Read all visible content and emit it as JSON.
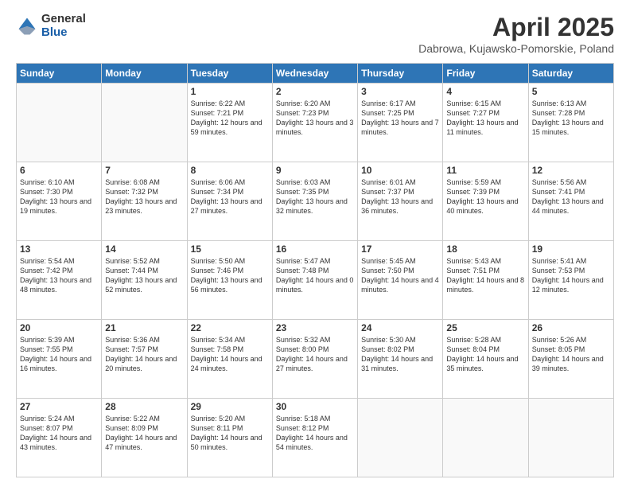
{
  "logo": {
    "general": "General",
    "blue": "Blue"
  },
  "title": {
    "main": "April 2025",
    "sub": "Dabrowa, Kujawsko-Pomorskie, Poland"
  },
  "weekdays": [
    "Sunday",
    "Monday",
    "Tuesday",
    "Wednesday",
    "Thursday",
    "Friday",
    "Saturday"
  ],
  "weeks": [
    [
      {
        "day": "",
        "info": ""
      },
      {
        "day": "",
        "info": ""
      },
      {
        "day": "1",
        "info": "Sunrise: 6:22 AM\nSunset: 7:21 PM\nDaylight: 12 hours and 59 minutes."
      },
      {
        "day": "2",
        "info": "Sunrise: 6:20 AM\nSunset: 7:23 PM\nDaylight: 13 hours and 3 minutes."
      },
      {
        "day": "3",
        "info": "Sunrise: 6:17 AM\nSunset: 7:25 PM\nDaylight: 13 hours and 7 minutes."
      },
      {
        "day": "4",
        "info": "Sunrise: 6:15 AM\nSunset: 7:27 PM\nDaylight: 13 hours and 11 minutes."
      },
      {
        "day": "5",
        "info": "Sunrise: 6:13 AM\nSunset: 7:28 PM\nDaylight: 13 hours and 15 minutes."
      }
    ],
    [
      {
        "day": "6",
        "info": "Sunrise: 6:10 AM\nSunset: 7:30 PM\nDaylight: 13 hours and 19 minutes."
      },
      {
        "day": "7",
        "info": "Sunrise: 6:08 AM\nSunset: 7:32 PM\nDaylight: 13 hours and 23 minutes."
      },
      {
        "day": "8",
        "info": "Sunrise: 6:06 AM\nSunset: 7:34 PM\nDaylight: 13 hours and 27 minutes."
      },
      {
        "day": "9",
        "info": "Sunrise: 6:03 AM\nSunset: 7:35 PM\nDaylight: 13 hours and 32 minutes."
      },
      {
        "day": "10",
        "info": "Sunrise: 6:01 AM\nSunset: 7:37 PM\nDaylight: 13 hours and 36 minutes."
      },
      {
        "day": "11",
        "info": "Sunrise: 5:59 AM\nSunset: 7:39 PM\nDaylight: 13 hours and 40 minutes."
      },
      {
        "day": "12",
        "info": "Sunrise: 5:56 AM\nSunset: 7:41 PM\nDaylight: 13 hours and 44 minutes."
      }
    ],
    [
      {
        "day": "13",
        "info": "Sunrise: 5:54 AM\nSunset: 7:42 PM\nDaylight: 13 hours and 48 minutes."
      },
      {
        "day": "14",
        "info": "Sunrise: 5:52 AM\nSunset: 7:44 PM\nDaylight: 13 hours and 52 minutes."
      },
      {
        "day": "15",
        "info": "Sunrise: 5:50 AM\nSunset: 7:46 PM\nDaylight: 13 hours and 56 minutes."
      },
      {
        "day": "16",
        "info": "Sunrise: 5:47 AM\nSunset: 7:48 PM\nDaylight: 14 hours and 0 minutes."
      },
      {
        "day": "17",
        "info": "Sunrise: 5:45 AM\nSunset: 7:50 PM\nDaylight: 14 hours and 4 minutes."
      },
      {
        "day": "18",
        "info": "Sunrise: 5:43 AM\nSunset: 7:51 PM\nDaylight: 14 hours and 8 minutes."
      },
      {
        "day": "19",
        "info": "Sunrise: 5:41 AM\nSunset: 7:53 PM\nDaylight: 14 hours and 12 minutes."
      }
    ],
    [
      {
        "day": "20",
        "info": "Sunrise: 5:39 AM\nSunset: 7:55 PM\nDaylight: 14 hours and 16 minutes."
      },
      {
        "day": "21",
        "info": "Sunrise: 5:36 AM\nSunset: 7:57 PM\nDaylight: 14 hours and 20 minutes."
      },
      {
        "day": "22",
        "info": "Sunrise: 5:34 AM\nSunset: 7:58 PM\nDaylight: 14 hours and 24 minutes."
      },
      {
        "day": "23",
        "info": "Sunrise: 5:32 AM\nSunset: 8:00 PM\nDaylight: 14 hours and 27 minutes."
      },
      {
        "day": "24",
        "info": "Sunrise: 5:30 AM\nSunset: 8:02 PM\nDaylight: 14 hours and 31 minutes."
      },
      {
        "day": "25",
        "info": "Sunrise: 5:28 AM\nSunset: 8:04 PM\nDaylight: 14 hours and 35 minutes."
      },
      {
        "day": "26",
        "info": "Sunrise: 5:26 AM\nSunset: 8:05 PM\nDaylight: 14 hours and 39 minutes."
      }
    ],
    [
      {
        "day": "27",
        "info": "Sunrise: 5:24 AM\nSunset: 8:07 PM\nDaylight: 14 hours and 43 minutes."
      },
      {
        "day": "28",
        "info": "Sunrise: 5:22 AM\nSunset: 8:09 PM\nDaylight: 14 hours and 47 minutes."
      },
      {
        "day": "29",
        "info": "Sunrise: 5:20 AM\nSunset: 8:11 PM\nDaylight: 14 hours and 50 minutes."
      },
      {
        "day": "30",
        "info": "Sunrise: 5:18 AM\nSunset: 8:12 PM\nDaylight: 14 hours and 54 minutes."
      },
      {
        "day": "",
        "info": ""
      },
      {
        "day": "",
        "info": ""
      },
      {
        "day": "",
        "info": ""
      }
    ]
  ]
}
